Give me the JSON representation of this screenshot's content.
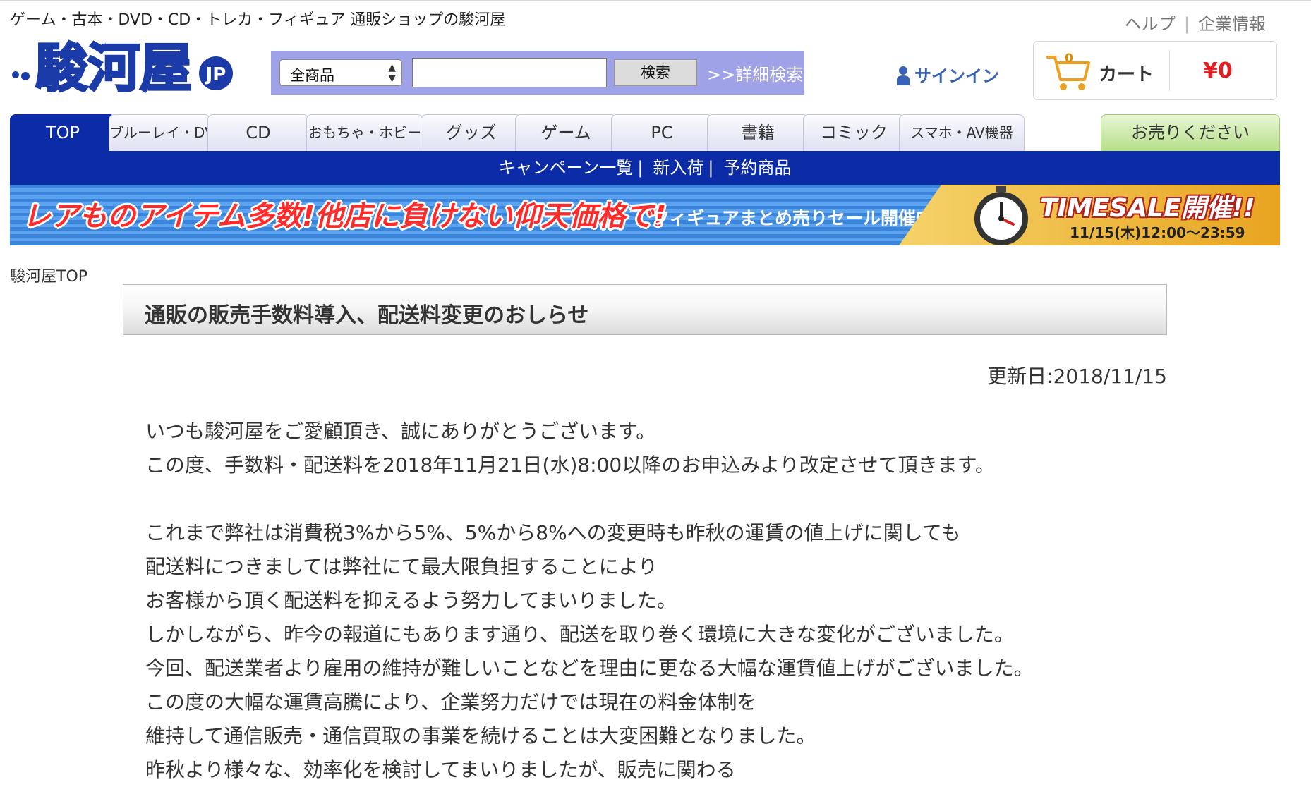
{
  "header": {
    "tagline": "ゲーム・古本・DVD・CD・トレカ・フィギュア 通販ショップの駿河屋",
    "help": "ヘルプ",
    "company": "企業情報",
    "logo_text": "駿河屋",
    "logo_badge": "JP"
  },
  "search": {
    "category": "全商品",
    "query": "",
    "button": "検索",
    "advanced": ">>詳細検索"
  },
  "account": {
    "signin": "サインイン"
  },
  "cart": {
    "count": "0",
    "label": "カート",
    "price": "¥0"
  },
  "tabs": [
    {
      "label": "TOP"
    },
    {
      "label": "ブルーレイ・DVD"
    },
    {
      "label": "CD"
    },
    {
      "label": "おもちゃ・ホビー"
    },
    {
      "label": "グッズ"
    },
    {
      "label": "ゲーム"
    },
    {
      "label": "PC"
    },
    {
      "label": "書籍"
    },
    {
      "label": "コミック"
    },
    {
      "label": "スマホ・AV機器"
    },
    {
      "label": "お売りください"
    }
  ],
  "subnav": [
    {
      "label": "キャンペーン一覧"
    },
    {
      "label": "新入荷"
    },
    {
      "label": "予約商品"
    }
  ],
  "banner": {
    "headline": "レアものアイテム多数!他店に負けない仰天価格で!",
    "subline": "フィギュアまとめ売りセール開催中!",
    "timesale": "TIMESALE開催!!",
    "timesale_date": "11/15(木)12:00〜23:59"
  },
  "breadcrumb": "駿河屋TOP",
  "article": {
    "title": "通販の販売手数料導入、配送料変更のおしらせ",
    "updated": "更新日:2018/11/15",
    "p1": [
      "いつも駿河屋をご愛顧頂き、誠にありがとうございます。",
      "この度、手数料・配送料を2018年11月21日(水)8:00以降のお申込みより改定させて頂きます。"
    ],
    "p2": [
      "これまで弊社は消費税3%から5%、5%から8%への変更時も昨秋の運賃の値上げに関しても",
      "配送料につきましては弊社にて最大限負担することにより",
      "お客様から頂く配送料を抑えるよう努力してまいりました。",
      "しかしながら、昨今の報道にもあります通り、配送を取り巻く環境に大きな変化がございました。",
      "今回、配送業者より雇用の維持が難しいことなどを理由に更なる大幅な運賃値上げがございました。",
      "この度の大幅な運賃高騰により、企業努力だけでは現在の料金体制を",
      "維持して通信販売・通信買取の事業を続けることは大変困難となりました。",
      "昨秋より様々な、効率化を検討してまいりましたが、販売に関わる"
    ]
  }
}
